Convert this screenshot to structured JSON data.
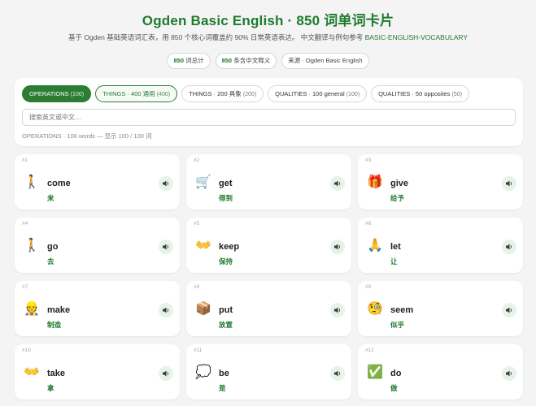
{
  "header": {
    "title": "Ogden Basic English · 850 词单词卡片",
    "subtitle_text": "基于 Ogden 基础英语词汇表，用 850 个核心词覆盖约 90% 日常英语表达。 中文翻译与例句参考",
    "subtitle_link": "BASIC-ENGLISH-VOCABULARY"
  },
  "stats": [
    {
      "value": "850",
      "label": "词总计"
    },
    {
      "value": "850",
      "label": "条含中文释义"
    },
    {
      "value": "",
      "label": "来源 · Ogden Basic English"
    }
  ],
  "tabs": [
    {
      "label": "OPERATIONS",
      "count": "(100)"
    },
    {
      "label": "THINGS · 400 通用",
      "count": "(400)"
    },
    {
      "label": "THINGS · 200 具象",
      "count": "(200)"
    },
    {
      "label": "QUALITIES · 100 general",
      "count": "(100)"
    },
    {
      "label": "QUALITIES · 50 opposites",
      "count": "(50)"
    }
  ],
  "search": {
    "placeholder": "搜索英文或中文…",
    "value": ""
  },
  "result_info": "OPERATIONS · 100 words — 显示 100 / 100 词",
  "colors": {
    "accent": "#1f7a2e",
    "accent_bg": "#2b7d33",
    "speaker_bg": "#e7f2e8"
  },
  "speaker_icon": "speaker-icon",
  "cards": [
    {
      "num": "#1",
      "emoji": "🚶",
      "word": "come",
      "zh": "来"
    },
    {
      "num": "#2",
      "emoji": "🛒",
      "word": "get",
      "zh": "得到"
    },
    {
      "num": "#3",
      "emoji": "🎁",
      "word": "give",
      "zh": "给予"
    },
    {
      "num": "#4",
      "emoji": "🚶",
      "word": "go",
      "zh": "去"
    },
    {
      "num": "#5",
      "emoji": "👐",
      "word": "keep",
      "zh": "保持"
    },
    {
      "num": "#6",
      "emoji": "🙏",
      "word": "let",
      "zh": "让"
    },
    {
      "num": "#7",
      "emoji": "👷",
      "word": "make",
      "zh": "制造"
    },
    {
      "num": "#8",
      "emoji": "📦",
      "word": "put",
      "zh": "放置"
    },
    {
      "num": "#9",
      "emoji": "🧐",
      "word": "seem",
      "zh": "似乎"
    },
    {
      "num": "#10",
      "emoji": "👐",
      "word": "take",
      "zh": "拿"
    },
    {
      "num": "#11",
      "emoji": "💭",
      "word": "be",
      "zh": "是"
    },
    {
      "num": "#12",
      "emoji": "✅",
      "word": "do",
      "zh": "做"
    }
  ]
}
